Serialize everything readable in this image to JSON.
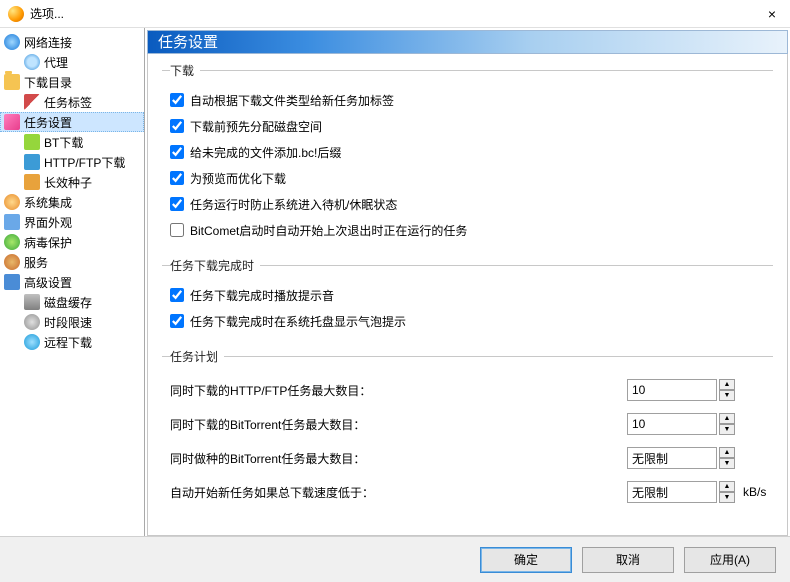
{
  "window": {
    "title": "选项...",
    "close_glyph": "×"
  },
  "sidebar": [
    {
      "key": "net",
      "label": "网络连接",
      "icon": "ic-globe",
      "children": [
        {
          "key": "proxy",
          "label": "代理",
          "icon": "ic-proxy"
        }
      ]
    },
    {
      "key": "dldir",
      "label": "下载目录",
      "icon": "ic-folder",
      "children": [
        {
          "key": "tag",
          "label": "任务标签",
          "icon": "ic-tag"
        }
      ]
    },
    {
      "key": "task",
      "label": "任务设置",
      "icon": "ic-task",
      "selected": true,
      "children": [
        {
          "key": "bt",
          "label": "BT下载",
          "icon": "ic-bt"
        },
        {
          "key": "http",
          "label": "HTTP/FTP下载",
          "icon": "ic-http"
        },
        {
          "key": "seed",
          "label": "长效种子",
          "icon": "ic-seed"
        }
      ]
    },
    {
      "key": "sys",
      "label": "系统集成",
      "icon": "ic-sys"
    },
    {
      "key": "ui",
      "label": "界面外观",
      "icon": "ic-ui"
    },
    {
      "key": "av",
      "label": "病毒保护",
      "icon": "ic-virus"
    },
    {
      "key": "svc",
      "label": "服务",
      "icon": "ic-svc"
    },
    {
      "key": "adv",
      "label": "高级设置",
      "icon": "ic-adv",
      "children": [
        {
          "key": "cache",
          "label": "磁盘缓存",
          "icon": "ic-cache"
        },
        {
          "key": "sched",
          "label": "时段限速",
          "icon": "ic-sched"
        },
        {
          "key": "remote",
          "label": "远程下载",
          "icon": "ic-remote"
        }
      ]
    }
  ],
  "panel": {
    "title": "任务设置",
    "groups": {
      "download": {
        "legend": "下载",
        "checks": [
          {
            "key": "autotag",
            "label": "自动根据下载文件类型给新任务加标签",
            "checked": true
          },
          {
            "key": "prealloc",
            "label": "下载前预先分配磁盘空间",
            "checked": true
          },
          {
            "key": "bcsuffix",
            "label": "给未完成的文件添加.bc!后缀",
            "checked": true
          },
          {
            "key": "preview",
            "label": "为预览而优化下载",
            "checked": true
          },
          {
            "key": "nosleep",
            "label": "任务运行时防止系统进入待机/休眠状态",
            "checked": true
          },
          {
            "key": "resume",
            "label": "BitComet启动时自动开始上次退出时正在运行的任务",
            "checked": false
          }
        ]
      },
      "complete": {
        "legend": "任务下载完成时",
        "checks": [
          {
            "key": "sound",
            "label": "任务下载完成时播放提示音",
            "checked": true
          },
          {
            "key": "bubble",
            "label": "任务下载完成时在系统托盘显示气泡提示",
            "checked": true
          }
        ]
      },
      "schedule": {
        "legend": "任务计划",
        "fields": [
          {
            "key": "max_http",
            "label": "同时下载的HTTP/FTP任务最大数目：",
            "value": "10",
            "unit": ""
          },
          {
            "key": "max_bt",
            "label": "同时下载的BitTorrent任务最大数目：",
            "value": "10",
            "unit": ""
          },
          {
            "key": "max_seed",
            "label": "同时做种的BitTorrent任务最大数目：",
            "value": "无限制",
            "unit": ""
          },
          {
            "key": "autostart",
            "label": "自动开始新任务如果总下载速度低于：",
            "value": "无限制",
            "unit": "kB/s"
          }
        ]
      }
    }
  },
  "footer": {
    "ok": "确定",
    "cancel": "取消",
    "apply": "应用(A)"
  }
}
